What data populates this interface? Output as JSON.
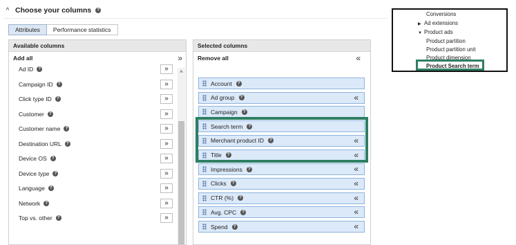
{
  "section": {
    "title": "Choose your columns"
  },
  "tabs": [
    {
      "label": "Attributes",
      "active": true
    },
    {
      "label": "Performance statistics",
      "active": false
    }
  ],
  "available": {
    "header": "Available columns",
    "add_all": "Add all",
    "items": [
      {
        "label": "Ad ID",
        "button": "»"
      },
      {
        "label": "Campaign ID",
        "button": "»"
      },
      {
        "label": "Click type ID",
        "button": "»"
      },
      {
        "label": "Customer",
        "button": "»"
      },
      {
        "label": "Customer name",
        "button": "»"
      },
      {
        "label": "Destination URL",
        "button": "»"
      },
      {
        "label": "Device OS",
        "button": "»"
      },
      {
        "label": "Device type",
        "button": "»"
      },
      {
        "label": "Language",
        "button": "»"
      },
      {
        "label": "Network",
        "button": "»"
      },
      {
        "label": "Top vs. other",
        "button": "»"
      }
    ]
  },
  "selected": {
    "header": "Selected columns",
    "remove_all": "Remove all",
    "items": [
      {
        "label": "Account",
        "removable": false
      },
      {
        "label": "Ad group",
        "removable": true
      },
      {
        "label": "Campaign",
        "removable": false
      },
      {
        "label": "Search term",
        "removable": false
      },
      {
        "label": "Merchant product ID",
        "removable": true
      },
      {
        "label": "Title",
        "removable": true
      },
      {
        "label": "Impressions",
        "removable": true
      },
      {
        "label": "Clicks",
        "removable": true
      },
      {
        "label": "CTR (%)",
        "removable": true
      },
      {
        "label": "Avg. CPC",
        "removable": true
      },
      {
        "label": "Spend",
        "removable": true
      }
    ]
  },
  "inset": {
    "items": [
      {
        "label": "Conversions",
        "marker": ""
      },
      {
        "label": "Ad extensions",
        "marker": "▶"
      },
      {
        "label": "Product ads",
        "marker": "▼"
      },
      {
        "label": "Product partition",
        "marker": ""
      },
      {
        "label": "Product partition unit",
        "marker": ""
      },
      {
        "label": "Product dimension",
        "marker": ""
      },
      {
        "label": "Product Search term",
        "marker": "",
        "bold": true
      }
    ]
  },
  "glyphs": {
    "add_all": "»",
    "remove": "«",
    "collapse": "^",
    "scroll_up": "^",
    "help": "?"
  },
  "colors": {
    "selected_fill": "#dbe9f9",
    "selected_border": "#8eb4dd",
    "highlight": "#2e7f63",
    "active_tab": "#dce7f3"
  }
}
